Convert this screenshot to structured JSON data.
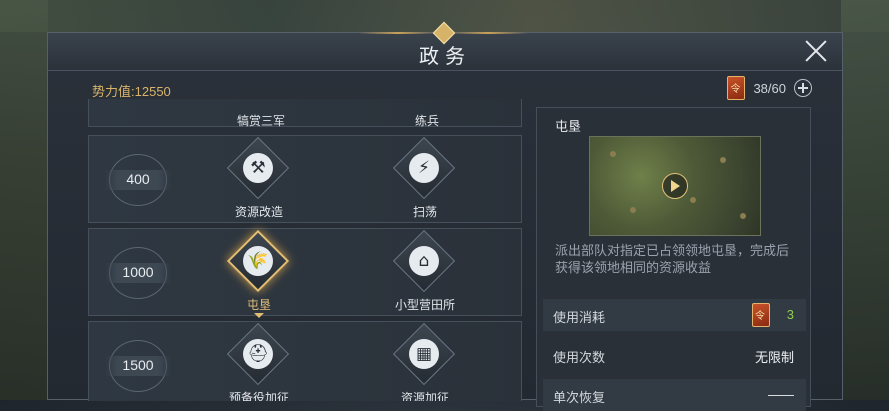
{
  "window": {
    "title": "政务"
  },
  "header": {
    "power_label": "势力值:",
    "power_value": "12550"
  },
  "resource": {
    "icon": "decree-card-icon",
    "current": "38",
    "max": "60",
    "text": "38/60"
  },
  "list": {
    "partial_row": {
      "labels": [
        "犒赏三军",
        "练兵"
      ]
    },
    "rows": [
      {
        "cost": "400",
        "skills": [
          {
            "label": "资源改造",
            "icon": "anvil-icon",
            "glyph": "⚒"
          },
          {
            "label": "扫荡",
            "icon": "sweep-icon",
            "glyph": "⚡"
          }
        ]
      },
      {
        "cost": "1000",
        "skills": [
          {
            "label": "屯垦",
            "icon": "wheat-icon",
            "glyph": "🌾",
            "selected": true
          },
          {
            "label": "小型营田所",
            "icon": "house-icon",
            "glyph": "⌂"
          }
        ]
      },
      {
        "cost": "1500",
        "skills": [
          {
            "label": "预备役加征",
            "icon": "helmet-icon",
            "glyph": "⛑"
          },
          {
            "label": "资源加征",
            "icon": "crates-icon",
            "glyph": "▦"
          }
        ]
      }
    ]
  },
  "detail": {
    "title": "屯垦",
    "description": "派出部队对指定已占领领地屯垦，完成后获得该领地相同的资源收益",
    "rows": [
      {
        "label": "使用消耗",
        "value": "3",
        "icon": "decree-card-icon"
      },
      {
        "label": "使用次数",
        "value": "无限制"
      },
      {
        "label": "单次恢复",
        "value": "——"
      }
    ]
  },
  "colors": {
    "accent_gold": "#d8b46b",
    "cost_green": "#8fcf4f"
  }
}
